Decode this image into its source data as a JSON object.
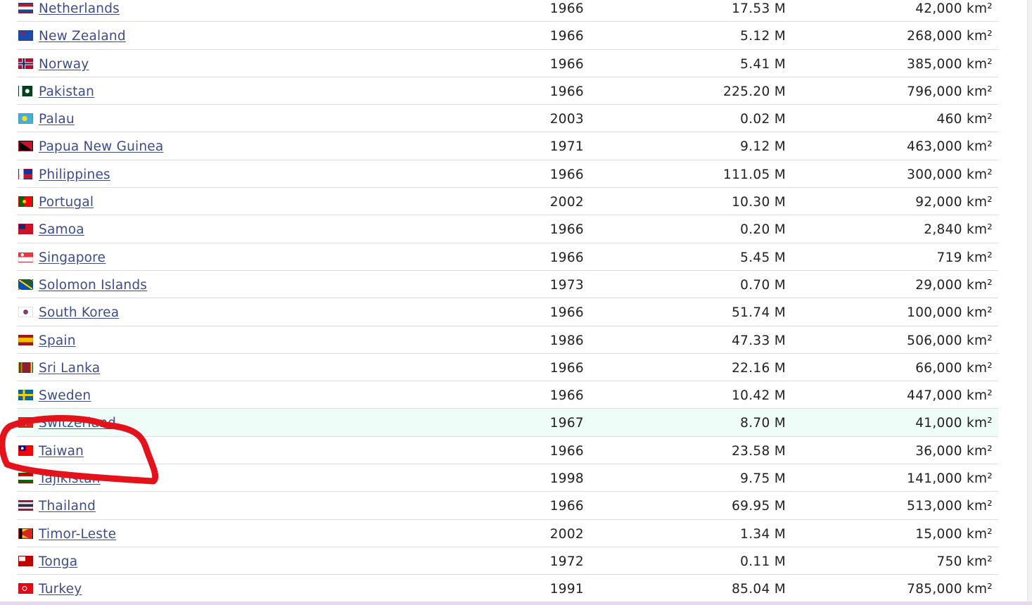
{
  "rows": [
    {
      "country": "Netherlands",
      "year": "1966",
      "population": "17.53 M",
      "area": "42,000 km²",
      "flag": "netherlands"
    },
    {
      "country": "New Zealand",
      "year": "1966",
      "population": "5.12 M",
      "area": "268,000 km²",
      "flag": "new-zealand"
    },
    {
      "country": "Norway",
      "year": "1966",
      "population": "5.41 M",
      "area": "385,000 km²",
      "flag": "norway"
    },
    {
      "country": "Pakistan",
      "year": "1966",
      "population": "225.20 M",
      "area": "796,000 km²",
      "flag": "pakistan"
    },
    {
      "country": "Palau",
      "year": "2003",
      "population": "0.02 M",
      "area": "460 km²",
      "flag": "palau"
    },
    {
      "country": "Papua New Guinea",
      "year": "1971",
      "population": "9.12 M",
      "area": "463,000 km²",
      "flag": "papua-new-guinea"
    },
    {
      "country": "Philippines",
      "year": "1966",
      "population": "111.05 M",
      "area": "300,000 km²",
      "flag": "philippines"
    },
    {
      "country": "Portugal",
      "year": "2002",
      "population": "10.30 M",
      "area": "92,000 km²",
      "flag": "portugal"
    },
    {
      "country": "Samoa",
      "year": "1966",
      "population": "0.20 M",
      "area": "2,840 km²",
      "flag": "samoa"
    },
    {
      "country": "Singapore",
      "year": "1966",
      "population": "5.45 M",
      "area": "719 km²",
      "flag": "singapore"
    },
    {
      "country": "Solomon Islands",
      "year": "1973",
      "population": "0.70 M",
      "area": "29,000 km²",
      "flag": "solomon-islands"
    },
    {
      "country": "South Korea",
      "year": "1966",
      "population": "51.74 M",
      "area": "100,000 km²",
      "flag": "south-korea"
    },
    {
      "country": "Spain",
      "year": "1986",
      "population": "47.33 M",
      "area": "506,000 km²",
      "flag": "spain"
    },
    {
      "country": "Sri Lanka",
      "year": "1966",
      "population": "22.16 M",
      "area": "66,000 km²",
      "flag": "sri-lanka"
    },
    {
      "country": "Sweden",
      "year": "1966",
      "population": "10.42 M",
      "area": "447,000 km²",
      "flag": "sweden"
    },
    {
      "country": "Switzerland",
      "year": "1967",
      "population": "8.70 M",
      "area": "41,000 km²",
      "flag": "switzerland"
    },
    {
      "country": "Taiwan",
      "year": "1966",
      "population": "23.58 M",
      "area": "36,000 km²",
      "flag": "taiwan"
    },
    {
      "country": "Tajikistan",
      "year": "1998",
      "population": "9.75 M",
      "area": "141,000 km²",
      "flag": "tajikistan"
    },
    {
      "country": "Thailand",
      "year": "1966",
      "population": "69.95 M",
      "area": "513,000 km²",
      "flag": "thailand"
    },
    {
      "country": "Timor-Leste",
      "year": "2002",
      "population": "1.34 M",
      "area": "15,000 km²",
      "flag": "timor-leste"
    },
    {
      "country": "Tonga",
      "year": "1972",
      "population": "0.11 M",
      "area": "750 km²",
      "flag": "tonga"
    },
    {
      "country": "Turkey",
      "year": "1991",
      "population": "85.04 M",
      "area": "785,000 km²",
      "flag": "turkey"
    }
  ],
  "highlighted_row": "Switzerland",
  "annotated_row": "Taiwan",
  "colors": {
    "link": "#3d4c8c",
    "row_border": "#dcdcdc",
    "highlight_row_bg": "#eefdf7",
    "annotation_stroke": "#e3121b"
  }
}
